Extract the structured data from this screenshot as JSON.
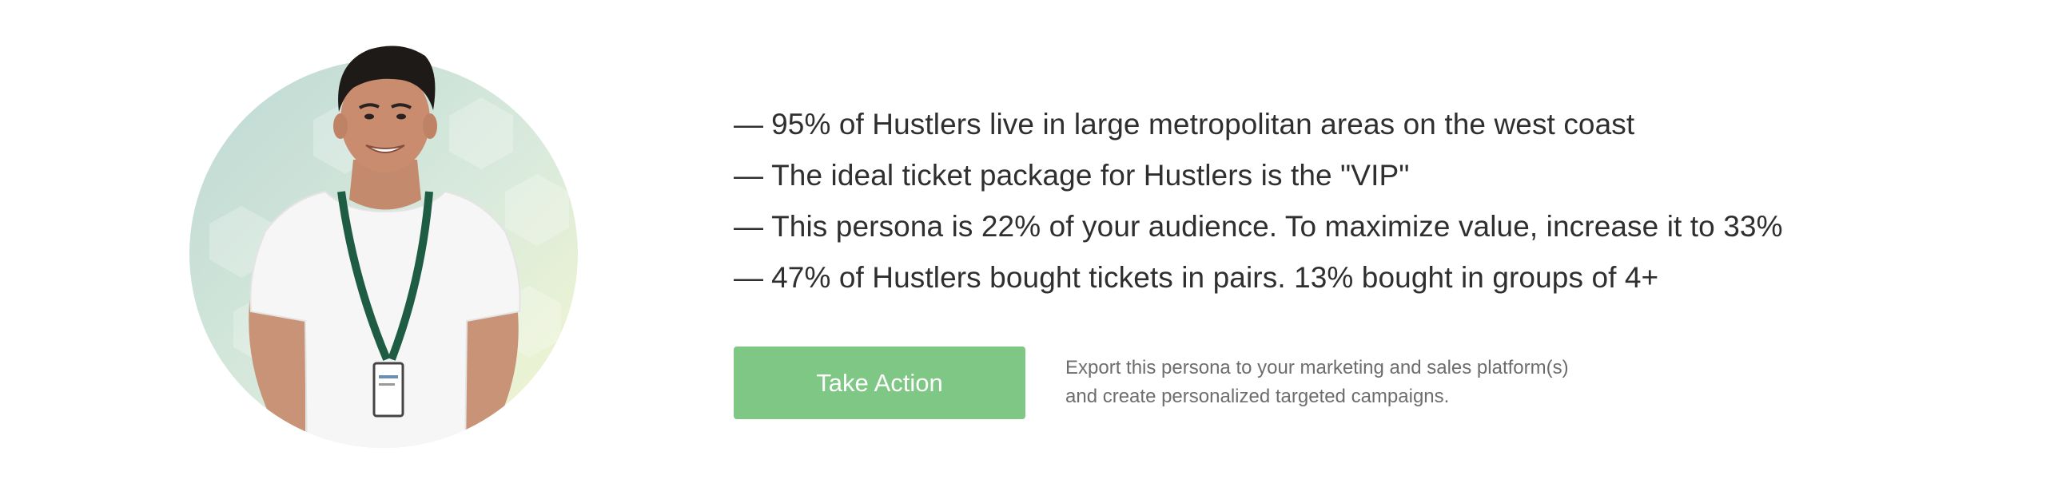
{
  "persona": {
    "bullets": [
      {
        "dash": "—",
        "text": "95% of Hustlers live in large metropolitan areas on the west coast"
      },
      {
        "dash": "—",
        "text": "The ideal ticket package for Hustlers is the \"VIP\""
      },
      {
        "dash": "—",
        "text": "This persona is 22% of your audience. To maximize value, increase it to 33%"
      },
      {
        "dash": "—",
        "text": "47% of Hustlers bought tickets in pairs. 13% bought in groups of 4+"
      }
    ],
    "action": {
      "button_label": "Take Action",
      "export_line1": "Export this persona to your marketing and sales platform(s)",
      "export_line2": "and create personalized targeted campaigns."
    }
  },
  "colors": {
    "button_bg": "#7fc785",
    "bullet_text": "#2f2f2f",
    "muted_text": "#6d6d6d",
    "circle_teal": "#c7dfd8",
    "circle_yellow": "#f3f6cf",
    "lanyard": "#1e5c43"
  }
}
